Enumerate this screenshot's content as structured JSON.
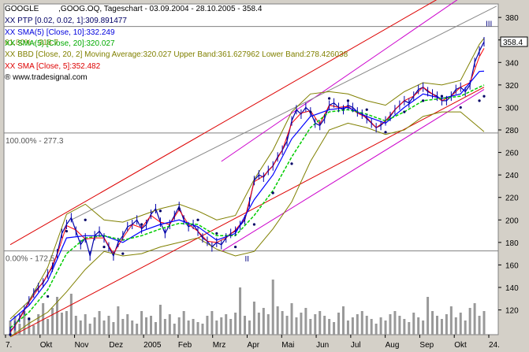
{
  "header": {
    "line1_symbol": "GOOGLE",
    "line1_rest": ",GOOG.OQ, Tageschart - 03.09.2004 - 28.10.2005 - 358.4",
    "line2": "XX PTP [0.02, 0.02, 1]:309.891477",
    "line3": "XX SMA(5) [Close, 10]:332.249",
    "line4": "XX SMA(5) [Close, 20]:320.027",
    "line5": "XX BBD [Close, 20, 2] Moving Average:320.027 Upper Band:361.627962 Lower Band:278.426038",
    "line6": "XX SMA [Close, 5]:352.482",
    "line7": "www.tradesignal.com",
    "overlap_text": "61.80% - 318.7"
  },
  "colors": {
    "price": "#0000aa",
    "ptp": "#000066",
    "sma10": "#0000ff",
    "sma20": "#00cc00",
    "bollinger": "#808000",
    "sma5": "#ff0000",
    "channel_red": "#dd0000",
    "channel_magenta": "#cc00cc",
    "trend_gray": "#888888",
    "volume": "#999999",
    "plot_bg": "#ffffff",
    "panel_bg": "#d4d0c8"
  },
  "chart_data": {
    "type": "line",
    "title": "GOOGLE ,GOOG.OQ, Tageschart - 03.09.2004 - 28.10.2005 - 358.4",
    "last_value": "358.4",
    "y_axis": {
      "ticks": [
        "120",
        "140",
        "160",
        "180",
        "200",
        "220",
        "240",
        "260",
        "280",
        "300",
        "320",
        "340",
        "360",
        "380"
      ],
      "range": [
        98,
        392
      ]
    },
    "x_axis": {
      "ticks": [
        "7.",
        "Okt",
        "Nov",
        "Dez",
        "2005",
        "Feb",
        "Mrz",
        "Apr",
        "Mai",
        "Jun",
        "Jul",
        "Aug",
        "Sep",
        "Okt",
        "24."
      ]
    },
    "fibonacci_levels": [
      {
        "label": "100.00% - 277.3",
        "value": 277.3
      },
      {
        "label": "0.00% - 172.5",
        "value": 172.5
      }
    ],
    "wave_labels": [
      "II",
      "III"
    ],
    "series": [
      {
        "name": "Close",
        "x": [
          0,
          6,
          12,
          18,
          24,
          30,
          36,
          42,
          48,
          54,
          60,
          66,
          72,
          78,
          84,
          90,
          96,
          102,
          108,
          114,
          120,
          126,
          132,
          138,
          144,
          150,
          156,
          162,
          168,
          174,
          180,
          186,
          192,
          198,
          204,
          210,
          216,
          222,
          228,
          234,
          240,
          246,
          252,
          258,
          264,
          270,
          276,
          282,
          288,
          294,
          300,
          306,
          312,
          318,
          324,
          330,
          336,
          342,
          348,
          354,
          360,
          366,
          372,
          378,
          384,
          390,
          396,
          402,
          408,
          414,
          420,
          426,
          432,
          438,
          444,
          450,
          456,
          462,
          468,
          474,
          480,
          486,
          492,
          498,
          504,
          510,
          516,
          522,
          528,
          534,
          540,
          546,
          552,
          558,
          564,
          570,
          576,
          582,
          588,
          594,
          600,
          606
        ],
        "y": [
          101,
          106,
          113,
          120,
          128,
          135,
          140,
          144,
          152,
          158,
          170,
          188,
          196,
          202,
          190,
          178,
          184,
          168,
          186,
          190,
          184,
          176,
          168,
          180,
          186,
          194,
          196,
          200,
          192,
          196,
          205,
          210,
          198,
          188,
          196,
          204,
          212,
          200,
          194,
          196,
          190,
          184,
          181,
          176,
          180,
          178,
          184,
          188,
          190,
          195,
          200,
          216,
          235,
          240,
          238,
          244,
          248,
          256,
          262,
          270,
          288,
          298,
          294,
          300,
          296,
          286,
          284,
          290,
          302,
          304,
          300,
          298,
          302,
          300,
          296,
          294,
          290,
          286,
          282,
          284,
          288,
          292,
          298,
          302,
          306,
          304,
          310,
          316,
          318,
          314,
          312,
          310,
          306,
          306,
          310,
          316,
          318,
          314,
          320,
          340,
          350,
          358.4
        ]
      },
      {
        "name": "SMA [Close, 5]",
        "values_note": "",
        "x": [
          0,
          12,
          24,
          36,
          48,
          60,
          72,
          84,
          96,
          108,
          120,
          132,
          144,
          156,
          168,
          180,
          192,
          204,
          216,
          228,
          240,
          252,
          264,
          276,
          288,
          300,
          312,
          324,
          336,
          348,
          360,
          372,
          384,
          396,
          408,
          420,
          432,
          444,
          456,
          468,
          480,
          492,
          504,
          516,
          528,
          540,
          552,
          564,
          576,
          588,
          600,
          606
        ],
        "y": [
          100,
          112,
          127,
          139,
          151,
          169,
          195,
          191,
          183,
          184,
          184,
          170,
          184,
          196,
          193,
          204,
          198,
          196,
          209,
          196,
          190,
          181,
          180,
          184,
          191,
          201,
          234,
          239,
          248,
          262,
          286,
          295,
          297,
          285,
          302,
          300,
          301,
          295,
          291,
          282,
          288,
          298,
          306,
          310,
          318,
          312,
          306,
          310,
          318,
          322,
          345,
          352.5
        ]
      },
      {
        "name": "SMA(5) [Close, 10]",
        "x": [
          0,
          24,
          48,
          72,
          96,
          120,
          144,
          168,
          192,
          216,
          240,
          264,
          288,
          312,
          336,
          360,
          384,
          408,
          432,
          456,
          480,
          504,
          528,
          552,
          576,
          600,
          606
        ],
        "y": [
          110,
          124,
          146,
          184,
          186,
          186,
          180,
          190,
          196,
          200,
          194,
          182,
          188,
          218,
          240,
          272,
          292,
          298,
          300,
          292,
          286,
          300,
          312,
          308,
          312,
          332,
          332.2
        ]
      },
      {
        "name": "SMA(5) [Close, 20]",
        "x": [
          0,
          24,
          48,
          72,
          96,
          120,
          144,
          168,
          192,
          216,
          240,
          264,
          288,
          312,
          336,
          360,
          384,
          408,
          432,
          456,
          480,
          504,
          528,
          552,
          576,
          600,
          606
        ],
        "y": [
          104,
          118,
          138,
          170,
          184,
          186,
          182,
          186,
          192,
          197,
          196,
          186,
          186,
          204,
          226,
          256,
          282,
          296,
          298,
          294,
          288,
          296,
          306,
          308,
          310,
          318,
          320
        ]
      },
      {
        "name": "BBD Upper Band",
        "x": [
          0,
          24,
          48,
          72,
          96,
          120,
          144,
          168,
          192,
          216,
          240,
          264,
          288,
          312,
          336,
          360,
          384,
          408,
          432,
          456,
          480,
          504,
          528,
          552,
          576,
          600,
          606
        ],
        "y": [
          112,
          128,
          158,
          205,
          214,
          200,
          198,
          204,
          210,
          214,
          208,
          200,
          204,
          236,
          262,
          296,
          312,
          314,
          312,
          306,
          302,
          314,
          322,
          320,
          324,
          356,
          361.6
        ]
      },
      {
        "name": "BBD Lower Band",
        "x": [
          0,
          24,
          48,
          72,
          96,
          120,
          144,
          168,
          192,
          216,
          240,
          264,
          288,
          312,
          336,
          360,
          384,
          408,
          432,
          456,
          480,
          504,
          528,
          552,
          576,
          600,
          606
        ],
        "y": [
          96,
          108,
          118,
          136,
          156,
          172,
          168,
          170,
          176,
          180,
          184,
          174,
          168,
          172,
          192,
          216,
          252,
          280,
          286,
          282,
          276,
          280,
          292,
          296,
          296,
          282,
          278.4
        ]
      },
      {
        "name": "PTP [0.02, 0.02, 1]",
        "x": [
          0,
          24,
          48,
          72,
          96,
          120,
          144,
          168,
          192,
          216,
          240,
          264,
          288,
          312,
          336,
          360,
          384,
          408,
          432,
          456,
          480,
          504,
          528,
          552,
          576,
          600,
          606
        ],
        "y": [
          98,
          112,
          132,
          190,
          200,
          176,
          170,
          196,
          208,
          210,
          200,
          188,
          176,
          196,
          224,
          250,
          296,
          308,
          306,
          298,
          278,
          296,
          306,
          310,
          300,
          306,
          309.9
        ]
      }
    ],
    "volume": {
      "x": [
        0,
        6,
        12,
        18,
        24,
        30,
        36,
        42,
        48,
        54,
        60,
        66,
        72,
        78,
        84,
        90,
        96,
        102,
        108,
        114,
        120,
        126,
        132,
        138,
        144,
        150,
        156,
        162,
        168,
        174,
        180,
        186,
        192,
        198,
        204,
        210,
        216,
        222,
        228,
        234,
        240,
        246,
        252,
        258,
        264,
        270,
        276,
        282,
        288,
        294,
        300,
        306,
        312,
        318,
        324,
        330,
        336,
        342,
        348,
        354,
        360,
        366,
        372,
        378,
        384,
        390,
        396,
        402,
        408,
        414,
        420,
        426,
        432,
        438,
        444,
        450,
        456,
        462,
        468,
        474,
        480,
        486,
        492,
        498,
        504,
        510,
        516,
        522,
        528,
        534,
        540,
        546,
        552,
        558,
        564,
        570,
        576,
        582,
        588,
        594,
        600,
        606
      ],
      "values": [
        18,
        24,
        14,
        30,
        22,
        12,
        26,
        40,
        20,
        34,
        48,
        28,
        30,
        52,
        24,
        18,
        26,
        14,
        22,
        30,
        18,
        24,
        16,
        36,
        20,
        26,
        18,
        14,
        30,
        22,
        24,
        16,
        38,
        20,
        26,
        14,
        22,
        30,
        18,
        20,
        16,
        14,
        24,
        30,
        18,
        22,
        26,
        20,
        28,
        60,
        24,
        18,
        42,
        28,
        34,
        26,
        70,
        36,
        30,
        24,
        40,
        22,
        28,
        34,
        20,
        26,
        30,
        24,
        20,
        16,
        28,
        36,
        18,
        22,
        26,
        30,
        24,
        20,
        14,
        22,
        18,
        26,
        30,
        24,
        20,
        16,
        28,
        22,
        18,
        48,
        30,
        24,
        20,
        26,
        36,
        22,
        28,
        18,
        34,
        40,
        24,
        30
      ]
    }
  }
}
